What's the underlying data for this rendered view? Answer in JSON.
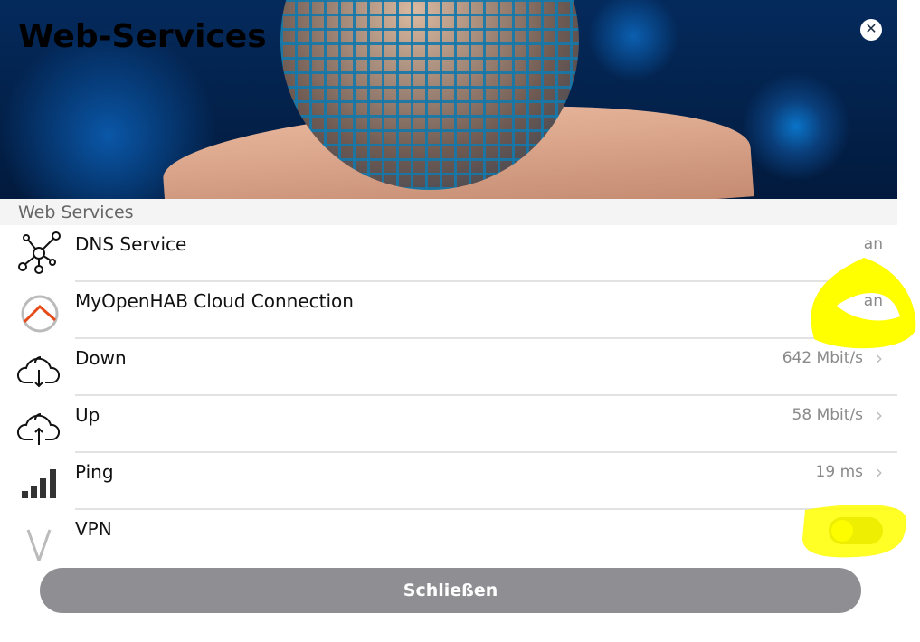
{
  "header": {
    "title": "Web-Services",
    "close_icon": "close-icon"
  },
  "section": {
    "title": "Web Services"
  },
  "rows": [
    {
      "label": "DNS Service",
      "value": "an",
      "icon": "network-icon"
    },
    {
      "label": "MyOpenHAB Cloud Connection",
      "value": "an",
      "icon": "openhab-icon"
    },
    {
      "label": "Down",
      "value": "642 Mbit/s",
      "icon": "cloud-download-icon",
      "chevron": "›"
    },
    {
      "label": "Up",
      "value": "58 Mbit/s",
      "icon": "cloud-upload-icon",
      "chevron": "›"
    },
    {
      "label": "Ping",
      "value": "19 ms",
      "icon": "signal-bars-icon",
      "chevron": "›"
    },
    {
      "label": "VPN",
      "icon": "vpn-icon",
      "toggle_on": false
    }
  ],
  "footer": {
    "close_label": "Schließen"
  },
  "colors": {
    "accent_openhab": "#e64a19",
    "button_bg": "#8e8e93",
    "highlight": "#ffff00"
  }
}
